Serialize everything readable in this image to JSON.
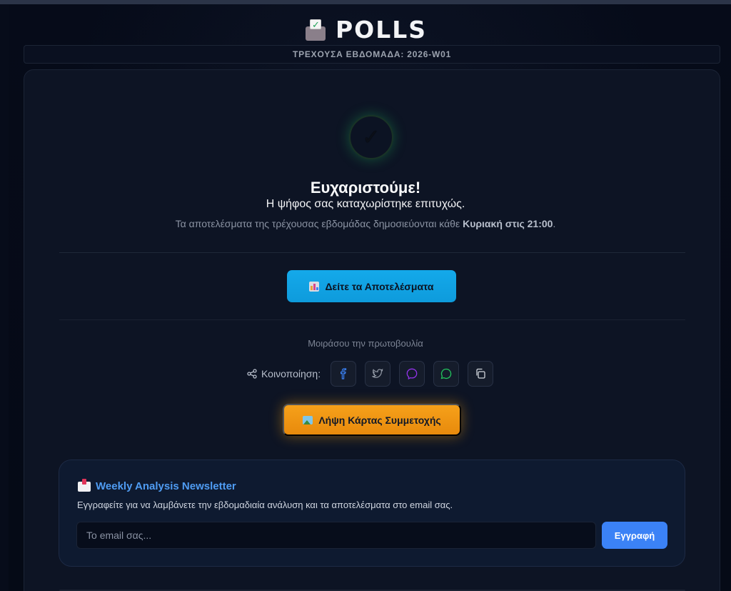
{
  "header": {
    "title": "POLLS",
    "logo_icon": "ballot-box-icon",
    "current_week": "ΤΡΕΧΟΥΣΑ ΕΒΔΟΜΑΔΑ: 2026-W01"
  },
  "confirmation": {
    "icon": "check-icon",
    "title": "Ευχαριστούμε!",
    "message": "Η ψήφος σας καταχωρίστηκε επιτυχώς.",
    "results_note_prefix": "Τα αποτελέσματα της τρέχουσας εβδομάδας δημοσιεύονται κάθε ",
    "results_note_time": "Κυριακή στις 21:00",
    "results_note_suffix": "."
  },
  "actions": {
    "view_results_label": "Δείτε τα Αποτελέσματα",
    "view_results_icon": "bar-chart-icon"
  },
  "share": {
    "caption": "Μοιράσου την πρωτοβουλία",
    "label": "Κοινοποίηση:",
    "label_icon": "share-icon",
    "buttons": [
      {
        "name": "facebook-icon",
        "color": "#3b82f6"
      },
      {
        "name": "twitter-icon",
        "color": "#9ca3af"
      },
      {
        "name": "messenger-icon",
        "color": "#9333ea"
      },
      {
        "name": "whatsapp-icon",
        "color": "#22c55e"
      },
      {
        "name": "copy-icon",
        "color": "#d1d5db"
      }
    ]
  },
  "participation": {
    "card_label": "Λήψη Κάρτας Συμμετοχής",
    "card_icon": "picture-icon"
  },
  "newsletter": {
    "icon": "envelope-icon",
    "title": "Weekly Analysis Newsletter",
    "description": "Εγγραφείτε για να λαμβάνετε την εβδομαδιαία ανάλυση και τα αποτελέσματα στο email σας.",
    "email_placeholder": "Το email σας...",
    "email_value": "",
    "subscribe_label": "Εγγραφή"
  },
  "colors": {
    "accent_blue": "#0ea5e9",
    "accent_orange": "#f59e0b",
    "newsletter_blue": "#3b82f6",
    "success_glow": "#22c55e"
  }
}
